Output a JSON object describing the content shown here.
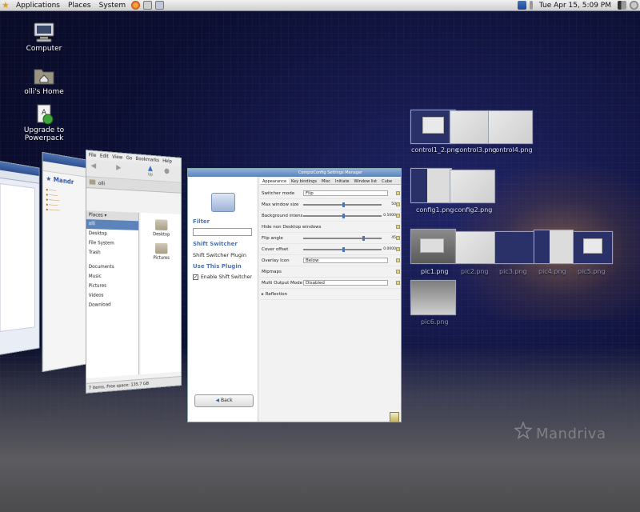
{
  "top_panel": {
    "menus": [
      "Applications",
      "Places",
      "System"
    ],
    "clock": "Tue Apr 15,  5:09 PM"
  },
  "desktop_icons": [
    {
      "label": "Computer",
      "icon": "computer-icon"
    },
    {
      "label": "olli's Home",
      "icon": "home-folder-icon"
    },
    {
      "label": "Upgrade to\nPowerpack",
      "icon": "upgrade-icon"
    }
  ],
  "file_manager": {
    "menu": [
      "File",
      "Edit",
      "View",
      "Go",
      "Bookmarks",
      "Help"
    ],
    "toolbar_up": "Up",
    "location": "olli",
    "places_header": "Places ▾",
    "places": [
      "olli",
      "Desktop",
      "File System",
      "Trash"
    ],
    "bookmarks": [
      "Documents",
      "Music",
      "Pictures",
      "Videos",
      "Download"
    ],
    "items": [
      "Desktop",
      "Pictures"
    ],
    "status": "7 items, Free space: 135.7 GB"
  },
  "config_window": {
    "title": "CompizConfig Settings Manager",
    "filter_label": "Filter",
    "shift_switcher": "Shift Switcher",
    "shift_switcher_plugin": "Shift Switcher Plugin",
    "use_this_plugin": "Use This Plugin",
    "enable_label": "Enable Shift Switcher",
    "back": "Back",
    "tabs": [
      "Appearance",
      "Key bindings",
      "Misc",
      "Initiate",
      "Window list",
      "Cube"
    ],
    "rows": [
      {
        "label": "Switcher mode",
        "value": "Flip"
      },
      {
        "label": "Max window size",
        "value": "50"
      },
      {
        "label": "Background intensity",
        "value": "0.5000"
      },
      {
        "label": "Hide non Desktop windows",
        "value": ""
      },
      {
        "label": "Flip angle",
        "value": "45"
      },
      {
        "label": "Cover offset",
        "value": "0.0000"
      },
      {
        "label": "Overlay Icon",
        "value": "Below"
      },
      {
        "label": "Mipmaps",
        "value": ""
      },
      {
        "label": "Multi Output Mode",
        "value": "Disabled"
      },
      {
        "label": "Reflection",
        "value": ""
      }
    ]
  },
  "thumbnails": [
    {
      "label": "control1_2.png"
    },
    {
      "label": "control3.png"
    },
    {
      "label": "control4.png"
    },
    {
      "label": "config1.png"
    },
    {
      "label": "config2.png"
    },
    {
      "label": "pic1.png"
    },
    {
      "label": "pic2.png"
    },
    {
      "label": "pic3.png"
    },
    {
      "label": "pic4.png"
    },
    {
      "label": "pic5.png"
    },
    {
      "label": "pic6.png"
    }
  ],
  "watermark": "Mandriva",
  "colors": {
    "desktop_bg": "#0c0f33",
    "accent": "#4f75b4",
    "glow": "#dc963c"
  }
}
